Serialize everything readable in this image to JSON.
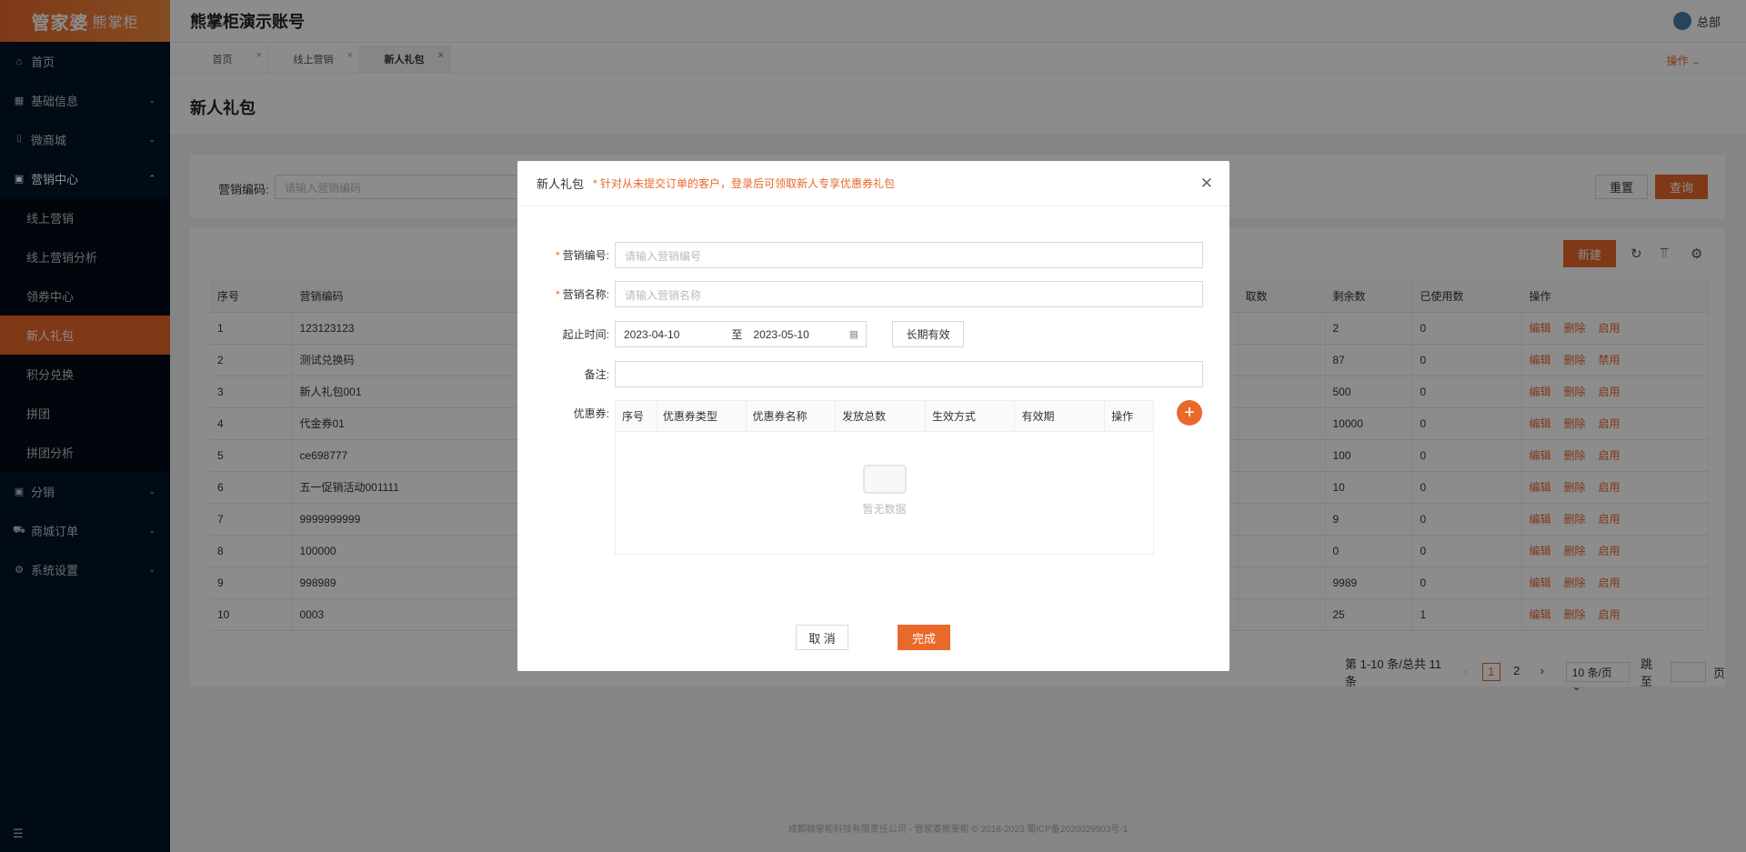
{
  "logo": {
    "main": "管家婆",
    "sub": "熊掌柜"
  },
  "header": {
    "title": "熊掌柜演示账号",
    "user": "总部"
  },
  "sidebar": {
    "items": [
      {
        "label": "首页",
        "icon": "⌂"
      },
      {
        "label": "基础信息",
        "icon": "▦"
      },
      {
        "label": "微商城",
        "icon": "⌷"
      },
      {
        "label": "营销中心",
        "icon": "▣"
      }
    ],
    "sub_items": [
      {
        "label": "线上营销"
      },
      {
        "label": "线上营销分析"
      },
      {
        "label": "领券中心"
      },
      {
        "label": "新人礼包"
      },
      {
        "label": "积分兑换"
      },
      {
        "label": "拼团"
      },
      {
        "label": "拼团分析"
      }
    ],
    "bottom_items": [
      {
        "label": "分销",
        "icon": "▣"
      },
      {
        "label": "商城订单",
        "icon": "⛟"
      },
      {
        "label": "系统设置",
        "icon": "⚙"
      }
    ]
  },
  "tabs": [
    {
      "label": "首页"
    },
    {
      "label": "线上营销"
    },
    {
      "label": "新人礼包"
    }
  ],
  "tabs_op": "操作 ⌄",
  "page": {
    "title": "新人礼包"
  },
  "filter": {
    "label": "营销编码:",
    "placeholder": "请输入营销编码",
    "reset": "重置",
    "query": "查询"
  },
  "toolbar": {
    "new": "新建"
  },
  "table": {
    "columns": [
      "序号",
      "营销编码",
      "取数",
      "剩余数",
      "已使用数",
      "操作"
    ],
    "rows": [
      {
        "idx": "1",
        "code": "123123123",
        "remain": "2",
        "used": "0",
        "toggle": "启用"
      },
      {
        "idx": "2",
        "code": "测试兑换码",
        "remain": "87",
        "used": "0",
        "toggle": "禁用"
      },
      {
        "idx": "3",
        "code": "新人礼包001",
        "remain": "500",
        "used": "0",
        "toggle": "启用"
      },
      {
        "idx": "4",
        "code": "代金券01",
        "remain": "10000",
        "used": "0",
        "toggle": "启用"
      },
      {
        "idx": "5",
        "code": "ce698777",
        "remain": "100",
        "used": "0",
        "toggle": "启用"
      },
      {
        "idx": "6",
        "code": "五一促销活动001111",
        "remain": "10",
        "used": "0",
        "toggle": "启用"
      },
      {
        "idx": "7",
        "code": "9999999999",
        "remain": "9",
        "used": "0",
        "toggle": "启用"
      },
      {
        "idx": "8",
        "code": "100000",
        "remain": "0",
        "used": "0",
        "toggle": "启用"
      },
      {
        "idx": "9",
        "code": "998989",
        "remain": "9989",
        "used": "0",
        "toggle": "启用"
      },
      {
        "idx": "10",
        "code": "0003",
        "remain": "25",
        "used": "1",
        "toggle": "启用"
      }
    ],
    "edit": "编辑",
    "delete": "删除"
  },
  "pager": {
    "summary": "第 1-10 条/总共 11 条",
    "page1": "1",
    "page2": "2",
    "size": "10 条/页 ⌄",
    "jump": "跳至",
    "unit": "页"
  },
  "footer": "成都翰掌柜科技有限责任公司 - 管家婆熊掌柜 © 2018-2023 蜀ICP备2020029903号-1",
  "modal": {
    "title": "新人礼包",
    "tip": "针对从未提交订单的客户，登录后可领取新人专享优惠券礼包",
    "code_label": "营销编号:",
    "code_placeholder": "请输入营销编号",
    "name_label": "营销名称:",
    "name_placeholder": "请输入营销名称",
    "time_label": "起止时间:",
    "start_date": "2023-04-10",
    "to": "至",
    "end_date": "2023-05-10",
    "long_valid": "长期有效",
    "remark_label": "备注:",
    "coupon_label": "优惠券:",
    "coupon_columns": [
      "序号",
      "优惠券类型",
      "优惠券名称",
      "发放总数",
      "生效方式",
      "有效期",
      "操作"
    ],
    "empty": "暂无数据",
    "cancel": "取 消",
    "done": "完成"
  },
  "colors": {
    "accent": "#e8692a",
    "sidebar": "#001529"
  }
}
